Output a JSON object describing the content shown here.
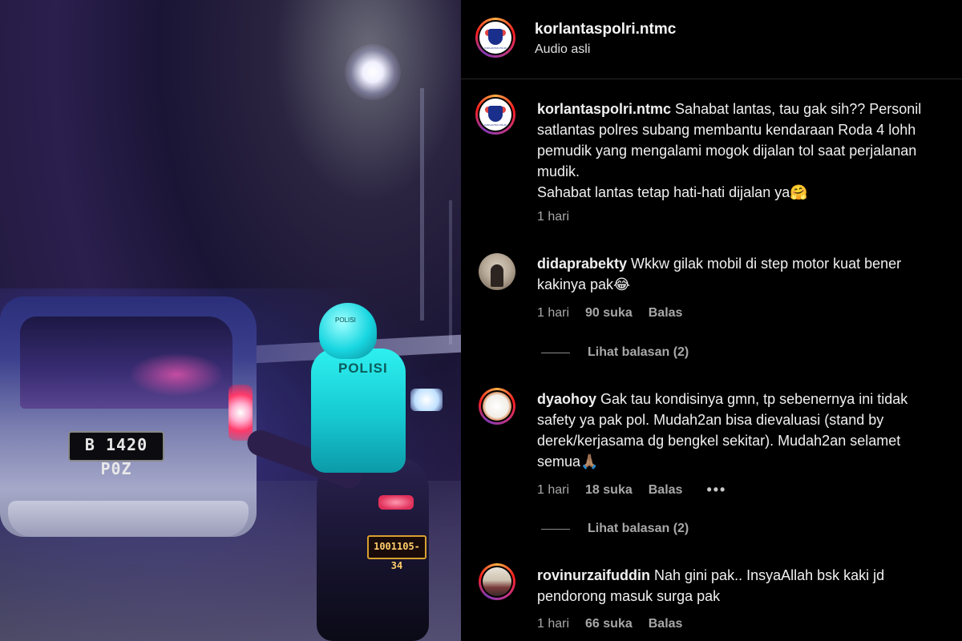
{
  "video": {
    "car_plate": "B 1420 P0Z",
    "helmet_text": "POLISI",
    "vest_text": "POLISI",
    "bike_plate": "1001105-34"
  },
  "header": {
    "username": "korlantaspolri.ntmc",
    "subtitle": "Audio asli",
    "avatar_icon": "korlantas-logo-icon"
  },
  "caption": {
    "username": "korlantaspolri.ntmc",
    "text": " Sahabat lantas, tau gak sih?? Personil\nsatlantas polres subang membantu kendaraan Roda 4 lohh\npemudik yang mengalami mogok dijalan tol saat perjalanan\nmudik.\nSahabat lantas tetap hati-hati dijalan ya🤗",
    "time": "1 hari"
  },
  "comments": [
    {
      "username": "didaprabekty",
      "text": " Wkkw gilak mobil di step motor kuat bener\nkakinya pak😂",
      "time": "1 hari",
      "likes": "90 suka",
      "reply": "Balas",
      "view_replies": "Lihat balasan (2)"
    },
    {
      "username": "dyaohoy",
      "text": " Gak tau kondisinya gmn, tp sebenernya ini tidak\nsafety ya pak pol. Mudah2an bisa dievaluasi (stand by\nderek/kerjasama dg bengkel sekitar). Mudah2an selamet\nsemua🙏🏽",
      "time": "1 hari",
      "likes": "18 suka",
      "reply": "Balas",
      "more": "•••",
      "view_replies": "Lihat balasan (2)"
    },
    {
      "username": "rovinurzaifuddin",
      "text": " Nah gini pak.. InsyaAllah bsk kaki jd\npendorong masuk surga pak",
      "time": "1 hari",
      "likes": "66 suka",
      "reply": "Balas"
    }
  ]
}
